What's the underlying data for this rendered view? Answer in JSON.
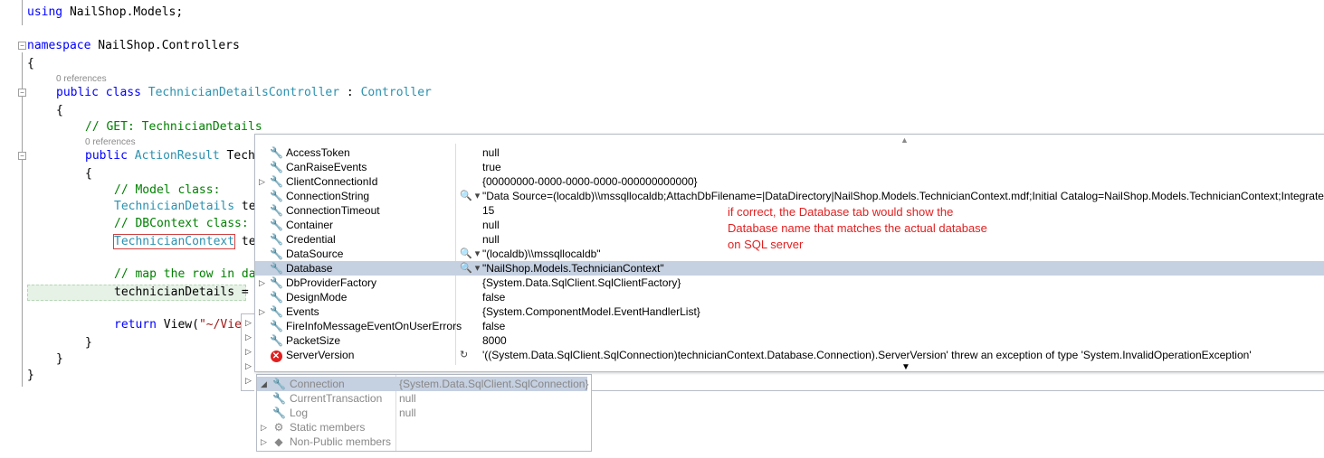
{
  "code": {
    "using_kw": "using",
    "using_ns": " NailShop.Models;",
    "namespace_kw": "namespace",
    "namespace_name": " NailShop.Controllers",
    "open_brace": "{",
    "refs_class": "0 references",
    "public_kw": "public",
    "class_kw": "class",
    "class_name": "TechnicianDetailsController",
    "class_sep": " : ",
    "base_class": "Controller",
    "class_open": "{",
    "comment_get": "// GET: TechnicianDetails",
    "refs_method": "0 references",
    "method_public": "public",
    "method_type": "ActionResult",
    "method_name_partial": " Tech",
    "method_open": "{",
    "comment_model": "// Model class:",
    "model_line_type": "TechnicianDetails",
    "model_line_rest": " te",
    "comment_dbcontext": "// DBContext class:",
    "context_type": "TechnicianContext",
    "context_rest": "te",
    "comment_map": "// map the row in da",
    "assign_line": "technicianDetails = ",
    "return_kw": "return",
    "return_call": " View(",
    "return_str": "\"~/Vie",
    "method_close": "}",
    "class_close": "}",
    "ns_close": "}"
  },
  "datatip": {
    "rows": [
      {
        "name": "AccessToken",
        "icon": "wrench-icon",
        "expand": "",
        "viz": "",
        "value": "null"
      },
      {
        "name": "CanRaiseEvents",
        "icon": "wrench-lock-icon",
        "expand": "",
        "viz": "",
        "value": "true"
      },
      {
        "name": "ClientConnectionId",
        "icon": "wrench-icon",
        "expand": "▷",
        "viz": "",
        "value": "{00000000-0000-0000-0000-000000000000}"
      },
      {
        "name": "ConnectionString",
        "icon": "wrench-icon",
        "expand": "",
        "viz": "🔍 ▾",
        "value": "\"Data Source=(localdb)\\\\mssqllocaldb;AttachDbFilename=|DataDirectory|NailShop.Models.TechnicianContext.mdf;Initial Catalog=NailShop.Models.TechnicianContext;Integrated Security=True\""
      },
      {
        "name": "ConnectionTimeout",
        "icon": "wrench-icon",
        "expand": "",
        "viz": "",
        "value": "15"
      },
      {
        "name": "Container",
        "icon": "wrench-icon",
        "expand": "",
        "viz": "",
        "value": "null"
      },
      {
        "name": "Credential",
        "icon": "wrench-icon",
        "expand": "",
        "viz": "",
        "value": "null"
      },
      {
        "name": "DataSource",
        "icon": "wrench-icon",
        "expand": "",
        "viz": "🔍 ▾",
        "value": "\"(localdb)\\\\mssqllocaldb\""
      },
      {
        "name": "Database",
        "icon": "wrench-icon",
        "expand": "",
        "viz": "🔍 ▾",
        "value": "\"NailShop.Models.TechnicianContext\""
      },
      {
        "name": "DbProviderFactory",
        "icon": "wrench-lock-icon",
        "expand": "▷",
        "viz": "",
        "value": "{System.Data.SqlClient.SqlClientFactory}"
      },
      {
        "name": "DesignMode",
        "icon": "wrench-lock-icon",
        "expand": "",
        "viz": "",
        "value": "false"
      },
      {
        "name": "Events",
        "icon": "wrench-lock-icon",
        "expand": "▷",
        "viz": "",
        "value": "{System.ComponentModel.EventHandlerList}"
      },
      {
        "name": "FireInfoMessageEventOnUserErrors",
        "icon": "wrench-icon",
        "expand": "",
        "viz": "",
        "value": "false"
      },
      {
        "name": "PacketSize",
        "icon": "wrench-icon",
        "expand": "",
        "viz": "",
        "value": "8000"
      },
      {
        "name": "ServerVersion",
        "icon": "error-icon",
        "expand": "",
        "viz": "↻",
        "value": "'((System.Data.SqlClient.SqlConnection)technicianContext.Database.Connection).ServerVersion' threw an exception of type 'System.InvalidOperationException'"
      }
    ],
    "selected_index": 8
  },
  "annotation": {
    "line1": "if correct, the Database tab would show the",
    "line2": "Database name that matches the actual database",
    "line3": "on SQL server"
  },
  "datatip2": {
    "rows": [
      {
        "name": "Connection",
        "icon": "wrench-icon",
        "expand": "◢",
        "value": "{System.Data.SqlClient.SqlConnection}"
      },
      {
        "name": "CurrentTransaction",
        "icon": "wrench-icon",
        "expand": "",
        "value": "null"
      },
      {
        "name": "Log",
        "icon": "wrench-icon",
        "expand": "",
        "value": "null"
      },
      {
        "name": "Static members",
        "icon": "static-members-icon",
        "expand": "▷",
        "value": ""
      },
      {
        "name": "Non-Public members",
        "icon": "nonpublic-members-icon",
        "expand": "▷",
        "value": ""
      }
    ]
  },
  "colors": {
    "keyword": "#0000ff",
    "type": "#2b91af",
    "comment": "#008000",
    "string": "#a31515",
    "annotation": "#e02020",
    "selection": "#c5d0e1"
  }
}
